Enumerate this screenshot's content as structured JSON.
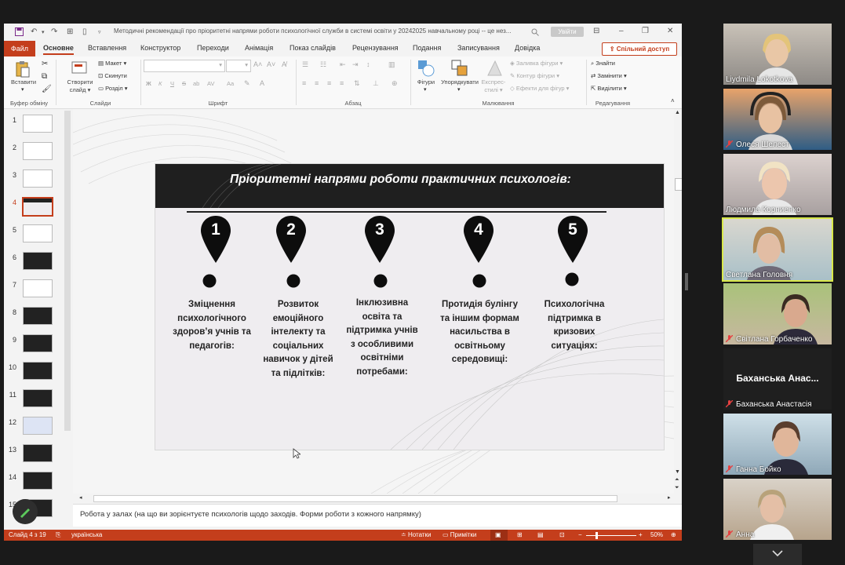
{
  "window": {
    "title": "Методичні рекомендації про пріоритетні напрями роботи психологічної служби в системі освіти у 20242025 навчальному році -- це нез...",
    "sign_in": "Увійти"
  },
  "tabs": [
    "Файл",
    "Основне",
    "Вставлення",
    "Конструктор",
    "Переходи",
    "Анімація",
    "Показ слайдів",
    "Рецензування",
    "Подання",
    "Записування",
    "Довідка"
  ],
  "share": "Спільний доступ",
  "ribbon": {
    "clipboard": {
      "paste": "Вставити",
      "group": "Буфер обміну"
    },
    "slides": {
      "new_slide_1": "Створити",
      "new_slide_2": "слайд",
      "layout": "Макет",
      "reset": "Скинути",
      "section": "Розділ",
      "group": "Слайди"
    },
    "font": {
      "group": "Шрифт",
      "bold": "Ж",
      "italic": "К",
      "underline": "Ч",
      "strike": "S",
      "shadow": "ab",
      "spacing": "AV",
      "case": "Aa"
    },
    "paragraph": {
      "group": "Абзац"
    },
    "drawing": {
      "shapes": "Фігури",
      "arrange": "Упорядкувати",
      "quick_styles_1": "Експрес-",
      "quick_styles_2": "стилі",
      "fill": "Заливка фігури",
      "outline": "Контур фігури",
      "effects": "Ефекти для фігур",
      "group": "Малювання"
    },
    "editing": {
      "find": "Знайти",
      "replace": "Замінити",
      "select": "Виділити",
      "group": "Редагування"
    }
  },
  "thumbnails": [
    "1",
    "2",
    "3",
    "4",
    "5",
    "6",
    "7",
    "8",
    "9",
    "10",
    "11",
    "12",
    "13",
    "14",
    "15"
  ],
  "slide": {
    "title": "Пріоритетні напрями роботи практичних психологів:",
    "items": [
      {
        "num": "1",
        "lines": [
          "Зміцнення",
          "психологічного",
          "здоров’я учнів та",
          "педагогів:"
        ]
      },
      {
        "num": "2",
        "lines": [
          "Розвиток",
          "емоційного",
          "інтелекту та",
          "соціальних",
          "навичок у дітей",
          "та підлітків:"
        ]
      },
      {
        "num": "3",
        "lines": [
          "Інклюзивна",
          "освіта та",
          "підтримка учнів",
          "з особливими",
          "освітніми",
          "потребами:"
        ]
      },
      {
        "num": "4",
        "lines": [
          "Протидія булінгу",
          "та іншим формам",
          "насильства в",
          "освітньому",
          "середовищі:"
        ]
      },
      {
        "num": "5",
        "lines": [
          "Психологічна",
          "підтримка в",
          "кризових",
          "ситуаціях:"
        ]
      }
    ]
  },
  "notes": "Робота у залах (на що ви зорієнтуєте психологів щодо заходів. Форми роботи з кожного напрямку)",
  "status": {
    "slide": "Слайд 4 з 19",
    "language": "українська",
    "notes_btn": "Нотатки",
    "comments_btn": "Примітки",
    "zoom": "50%"
  },
  "participants": [
    {
      "name": "Liydmila Lokotkova",
      "muted": false
    },
    {
      "name": "Олеся Шелест",
      "muted": true
    },
    {
      "name": "Людмила Корниенко",
      "muted": false
    },
    {
      "name": "Светлана Головня",
      "muted": false,
      "active": true
    },
    {
      "name": "Світлана Горбаченко",
      "muted": true
    },
    {
      "name": "Баханська Анастасія",
      "muted": true,
      "big": "Баханська Анас..."
    },
    {
      "name": "Ганна Бойко",
      "muted": true
    },
    {
      "name": "Анна",
      "muted": true
    }
  ],
  "colors": {
    "accent": "#c43e1c",
    "active_speaker": "#d8e84a",
    "banner": "#1f1f1f"
  }
}
